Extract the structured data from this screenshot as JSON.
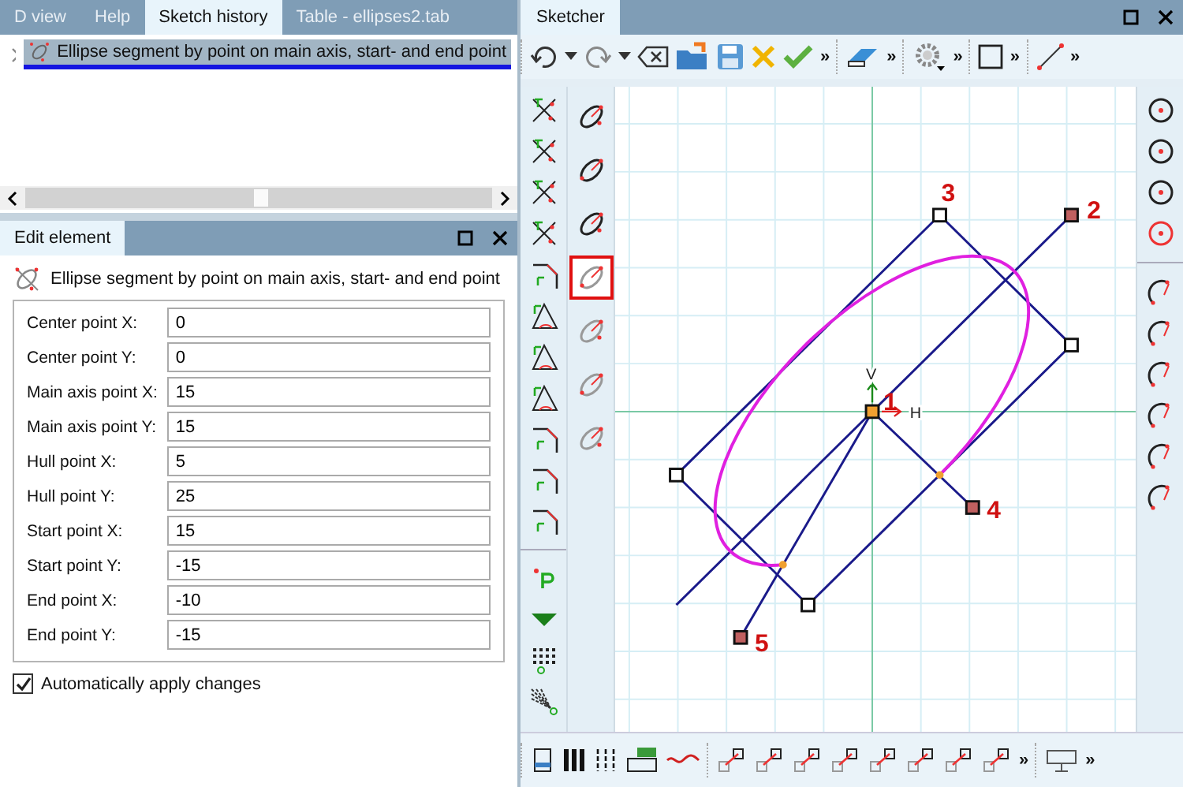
{
  "history_panel": {
    "tabs": [
      {
        "label": "D view",
        "selected": false
      },
      {
        "label": "Help",
        "selected": false
      },
      {
        "label": "Sketch history",
        "selected": true
      },
      {
        "label": "Table - ellipses2.tab",
        "selected": false
      }
    ],
    "tree": [
      {
        "label": "Ellipse segment by point on main axis, start- and end point",
        "selected": true,
        "expanded": false
      }
    ]
  },
  "edit_panel": {
    "tab": "Edit element",
    "title": "Ellipse segment by point on main axis, start- and end point",
    "fields": [
      {
        "label": "Center point X:",
        "value": "0"
      },
      {
        "label": "Center point Y:",
        "value": "0"
      },
      {
        "label": "Main axis point X:",
        "value": "15"
      },
      {
        "label": "Main axis point Y:",
        "value": "15"
      },
      {
        "label": "Hull point X:",
        "value": "5"
      },
      {
        "label": "Hull point Y:",
        "value": "25"
      },
      {
        "label": "Start point X:",
        "value": "15"
      },
      {
        "label": "Start point Y:",
        "value": "-15"
      },
      {
        "label": "End point X:",
        "value": "-10"
      },
      {
        "label": "End point Y:",
        "value": "-15"
      }
    ],
    "auto_apply": {
      "label": "Automatically apply changes",
      "checked": true
    }
  },
  "sketcher": {
    "title": "Sketcher",
    "top_toolbar": [
      {
        "overflow": "»"
      },
      {
        "overflow": "»"
      },
      {
        "overflow": "»"
      },
      {
        "overflow": "»"
      },
      {
        "overflow": "»"
      }
    ],
    "ellipse_tools": [
      {
        "selected": false
      },
      {
        "selected": false
      },
      {
        "selected": false
      },
      {
        "selected": true
      },
      {
        "selected": false
      },
      {
        "selected": false
      },
      {
        "selected": false
      }
    ],
    "axis_labels": [
      "V",
      "H"
    ],
    "point_labels": [
      "1",
      "2",
      "3",
      "4",
      "5"
    ],
    "bottom_toolbar": [
      {
        "overflow": "»"
      },
      {
        "overflow": "»"
      }
    ]
  }
}
